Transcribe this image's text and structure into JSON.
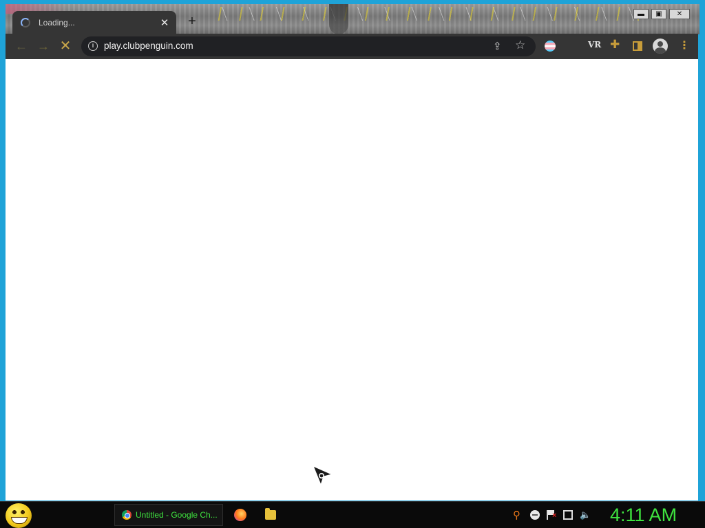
{
  "browser": {
    "tab": {
      "title": "Loading...",
      "close_glyph": "✕"
    },
    "new_tab_glyph": "+",
    "window_controls": {
      "minimize": "▬",
      "maximize": "▣",
      "close": "✕"
    },
    "nav": {
      "back_glyph": "←",
      "forward_glyph": "→",
      "stop_glyph": "✕"
    },
    "omnibox": {
      "url": "play.clubpenguin.com",
      "info_glyph": "i"
    },
    "extensions": {
      "vr_label": "VR",
      "menu_glyph": "⋮"
    }
  },
  "taskbar": {
    "active_item": {
      "label": "Untitled - Google Ch..."
    },
    "clock": "4:11 AM",
    "volume_glyph": "🔈"
  },
  "colors": {
    "accent_green": "#3fe33f",
    "chrome_dark": "#353535",
    "window_border": "#1fa3d8"
  }
}
